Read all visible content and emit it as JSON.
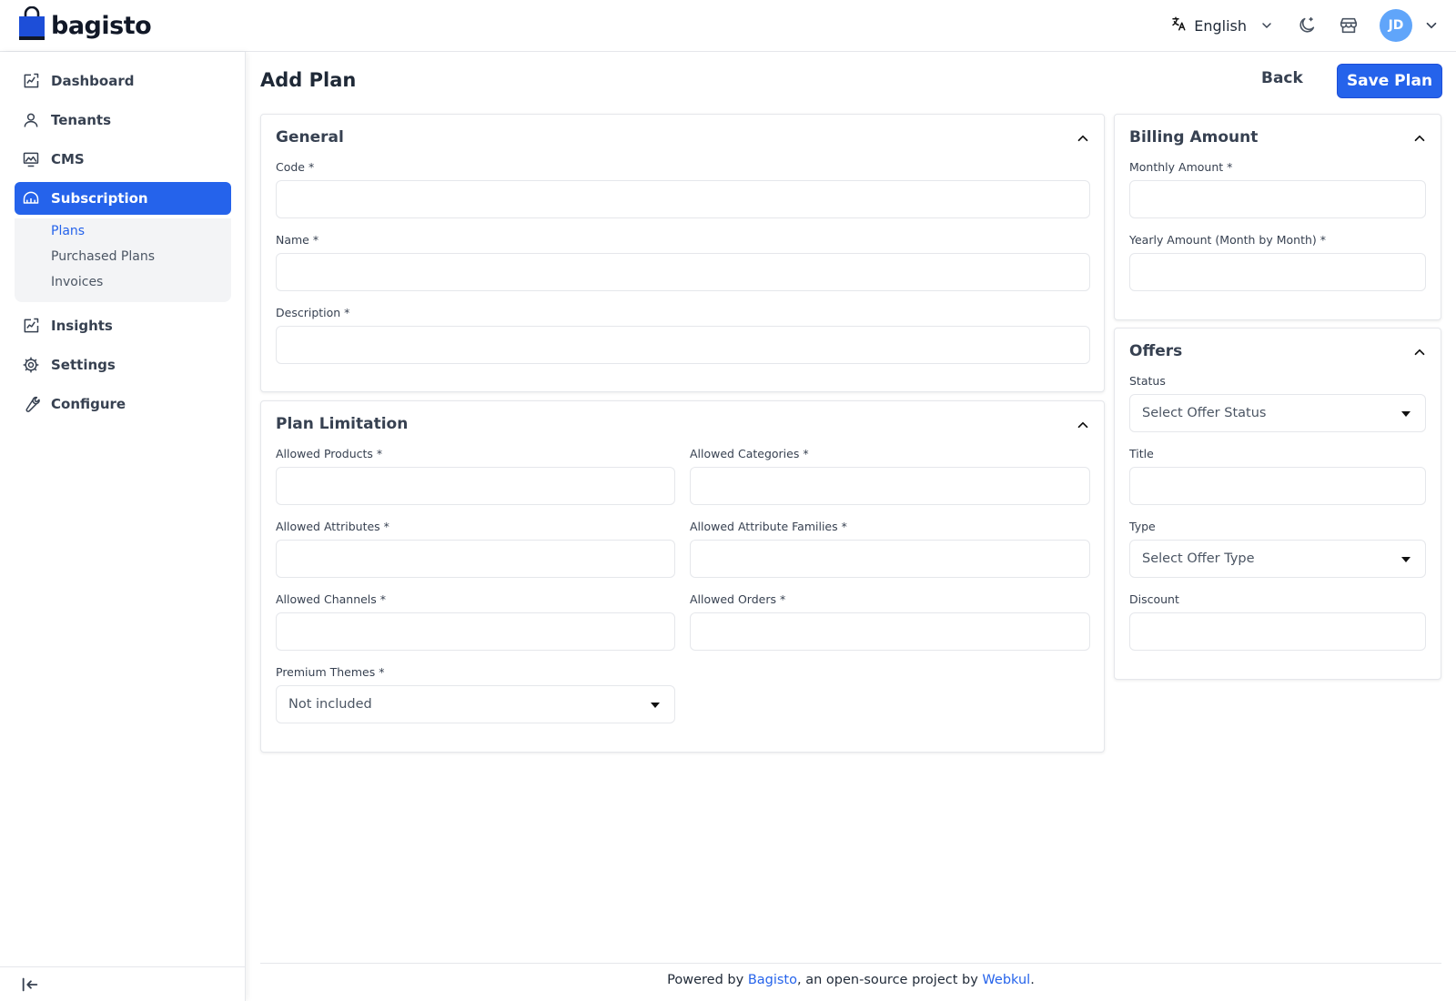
{
  "app": {
    "name": "bagisto"
  },
  "header": {
    "language": "English",
    "avatar_initials": "JD"
  },
  "sidebar": {
    "items": [
      {
        "label": "Dashboard",
        "icon": "dashboard-chart-icon"
      },
      {
        "label": "Tenants",
        "icon": "user-icon"
      },
      {
        "label": "CMS",
        "icon": "monitor-icon"
      },
      {
        "label": "Subscription",
        "icon": "subscription-icon",
        "active": true
      },
      {
        "label": "Insights",
        "icon": "insights-chart-icon"
      },
      {
        "label": "Settings",
        "icon": "gear-icon"
      },
      {
        "label": "Configure",
        "icon": "wrench-icon"
      }
    ],
    "subitems": [
      {
        "label": "Plans",
        "active": true
      },
      {
        "label": "Purchased Plans"
      },
      {
        "label": "Invoices"
      }
    ]
  },
  "page": {
    "title": "Add Plan",
    "back_label": "Back",
    "save_label": "Save Plan"
  },
  "general": {
    "title": "General",
    "code_label": "Code *",
    "name_label": "Name *",
    "description_label": "Description *"
  },
  "limitation": {
    "title": "Plan Limitation",
    "allowed_products_label": "Allowed Products *",
    "allowed_categories_label": "Allowed Categories *",
    "allowed_attributes_label": "Allowed Attributes *",
    "allowed_attribute_families_label": "Allowed Attribute Families *",
    "allowed_channels_label": "Allowed Channels *",
    "allowed_orders_label": "Allowed Orders *",
    "premium_themes_label": "Premium Themes *",
    "premium_themes_value": "Not included"
  },
  "billing": {
    "title": "Billing Amount",
    "monthly_label": "Monthly Amount *",
    "yearly_label": "Yearly Amount (Month by Month) *"
  },
  "offers": {
    "title": "Offers",
    "status_label": "Status",
    "status_value": "Select Offer Status",
    "title_label": "Title",
    "type_label": "Type",
    "type_value": "Select Offer Type",
    "discount_label": "Discount"
  },
  "footer": {
    "prefix": "Powered by ",
    "link1": "Bagisto",
    "middle": ", an open-source project by ",
    "link2": "Webkul",
    "suffix": "."
  },
  "colors": {
    "primary": "#2563eb",
    "avatar": "#60a5fa",
    "border": "#e5e7eb"
  }
}
